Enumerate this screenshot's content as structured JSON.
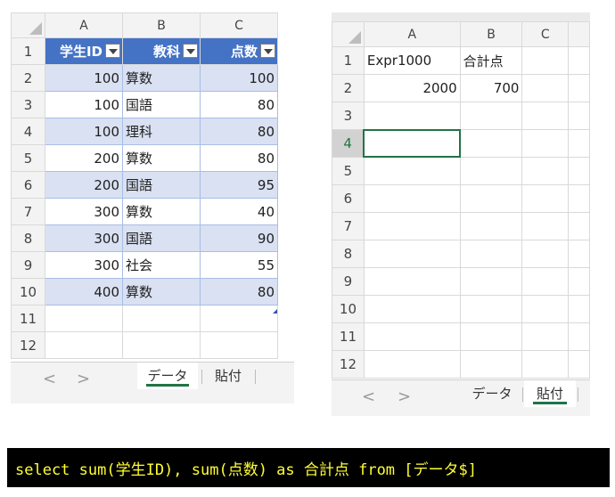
{
  "left_sheet": {
    "col_headers": [
      "A",
      "B",
      "C"
    ],
    "table_headers": [
      "学生ID",
      "教科",
      "点数"
    ],
    "rows": [
      {
        "num": "1"
      },
      {
        "num": "2",
        "a": "100",
        "b": "算数",
        "c": "100"
      },
      {
        "num": "3",
        "a": "100",
        "b": "国語",
        "c": "80"
      },
      {
        "num": "4",
        "a": "100",
        "b": "理科",
        "c": "80"
      },
      {
        "num": "5",
        "a": "200",
        "b": "算数",
        "c": "80"
      },
      {
        "num": "6",
        "a": "200",
        "b": "国語",
        "c": "95"
      },
      {
        "num": "7",
        "a": "300",
        "b": "算数",
        "c": "40"
      },
      {
        "num": "8",
        "a": "300",
        "b": "国語",
        "c": "90"
      },
      {
        "num": "9",
        "a": "300",
        "b": "社会",
        "c": "55"
      },
      {
        "num": "10",
        "a": "400",
        "b": "算数",
        "c": "80"
      },
      {
        "num": "11"
      },
      {
        "num": "12"
      }
    ],
    "tabs": [
      "データ",
      "貼付"
    ],
    "active_tab": "データ",
    "nav": {
      "prev": "<",
      "next": ">"
    }
  },
  "right_sheet": {
    "col_headers": [
      "A",
      "B",
      "C"
    ],
    "rows": [
      {
        "num": "1",
        "a": "Expr1000",
        "b": "合計点"
      },
      {
        "num": "2",
        "a": "2000",
        "b": "700"
      },
      {
        "num": "3"
      },
      {
        "num": "4"
      },
      {
        "num": "5"
      },
      {
        "num": "6"
      },
      {
        "num": "7"
      },
      {
        "num": "8"
      },
      {
        "num": "9"
      },
      {
        "num": "10"
      },
      {
        "num": "11"
      },
      {
        "num": "12"
      }
    ],
    "selected_row": "4",
    "tabs": [
      "データ",
      "貼付"
    ],
    "active_tab": "貼付",
    "nav": {
      "prev": "<",
      "next": ">"
    }
  },
  "sql": "select sum(学生ID), sum(点数) as 合計点 from [データ$]",
  "colors": {
    "table_header": "#4472c4",
    "band": "#d9e1f2",
    "accent": "#217346",
    "sql_text": "#ffff33"
  }
}
